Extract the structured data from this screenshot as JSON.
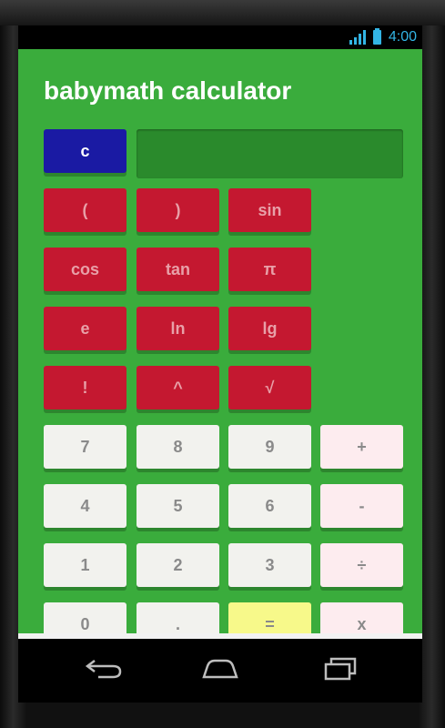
{
  "status_bar": {
    "time": "4:00"
  },
  "app": {
    "title": "babymath calculator",
    "display_value": ""
  },
  "buttons": {
    "clear": "c",
    "paren_open": "(",
    "paren_close": ")",
    "sin": "sin",
    "cos": "cos",
    "tan": "tan",
    "pi": "π",
    "e": "e",
    "ln": "ln",
    "lg": "lg",
    "factorial": "!",
    "power": "^",
    "sqrt": "√",
    "seven": "7",
    "eight": "8",
    "nine": "9",
    "plus": "+",
    "four": "4",
    "five": "5",
    "six": "6",
    "minus": "-",
    "one": "1",
    "two": "2",
    "three": "3",
    "divide": "÷",
    "zero": "0",
    "dot": ".",
    "equals": "=",
    "multiply": "x"
  },
  "colors": {
    "app_background": "#3aac3c",
    "display": "#2a8a2c",
    "clear_button": "#1a1aa3",
    "function_button": "#c41830",
    "number_button": "#f2f2ee",
    "operator_button": "#fdecef",
    "equals_button": "#f7f98a",
    "status_accent": "#33b5e5"
  },
  "nav_icons": [
    "back-icon",
    "home-icon",
    "recent-apps-icon"
  ]
}
